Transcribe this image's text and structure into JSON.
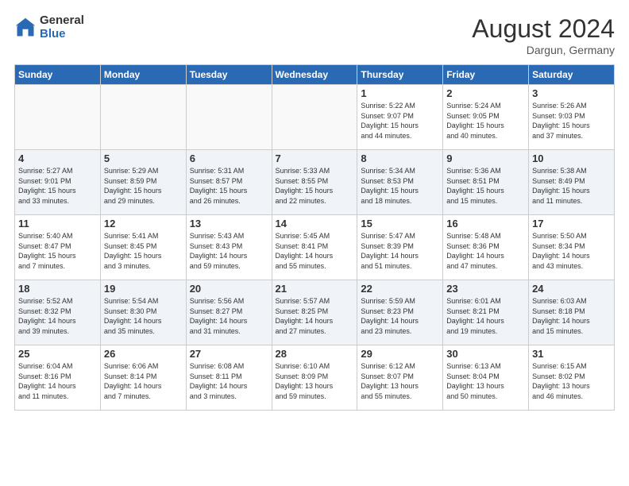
{
  "logo": {
    "general": "General",
    "blue": "Blue"
  },
  "header": {
    "month_year": "August 2024",
    "location": "Dargun, Germany"
  },
  "weekdays": [
    "Sunday",
    "Monday",
    "Tuesday",
    "Wednesday",
    "Thursday",
    "Friday",
    "Saturday"
  ],
  "weeks": [
    [
      {
        "day": "",
        "info": ""
      },
      {
        "day": "",
        "info": ""
      },
      {
        "day": "",
        "info": ""
      },
      {
        "day": "",
        "info": ""
      },
      {
        "day": "1",
        "info": "Sunrise: 5:22 AM\nSunset: 9:07 PM\nDaylight: 15 hours\nand 44 minutes."
      },
      {
        "day": "2",
        "info": "Sunrise: 5:24 AM\nSunset: 9:05 PM\nDaylight: 15 hours\nand 40 minutes."
      },
      {
        "day": "3",
        "info": "Sunrise: 5:26 AM\nSunset: 9:03 PM\nDaylight: 15 hours\nand 37 minutes."
      }
    ],
    [
      {
        "day": "4",
        "info": "Sunrise: 5:27 AM\nSunset: 9:01 PM\nDaylight: 15 hours\nand 33 minutes."
      },
      {
        "day": "5",
        "info": "Sunrise: 5:29 AM\nSunset: 8:59 PM\nDaylight: 15 hours\nand 29 minutes."
      },
      {
        "day": "6",
        "info": "Sunrise: 5:31 AM\nSunset: 8:57 PM\nDaylight: 15 hours\nand 26 minutes."
      },
      {
        "day": "7",
        "info": "Sunrise: 5:33 AM\nSunset: 8:55 PM\nDaylight: 15 hours\nand 22 minutes."
      },
      {
        "day": "8",
        "info": "Sunrise: 5:34 AM\nSunset: 8:53 PM\nDaylight: 15 hours\nand 18 minutes."
      },
      {
        "day": "9",
        "info": "Sunrise: 5:36 AM\nSunset: 8:51 PM\nDaylight: 15 hours\nand 15 minutes."
      },
      {
        "day": "10",
        "info": "Sunrise: 5:38 AM\nSunset: 8:49 PM\nDaylight: 15 hours\nand 11 minutes."
      }
    ],
    [
      {
        "day": "11",
        "info": "Sunrise: 5:40 AM\nSunset: 8:47 PM\nDaylight: 15 hours\nand 7 minutes."
      },
      {
        "day": "12",
        "info": "Sunrise: 5:41 AM\nSunset: 8:45 PM\nDaylight: 15 hours\nand 3 minutes."
      },
      {
        "day": "13",
        "info": "Sunrise: 5:43 AM\nSunset: 8:43 PM\nDaylight: 14 hours\nand 59 minutes."
      },
      {
        "day": "14",
        "info": "Sunrise: 5:45 AM\nSunset: 8:41 PM\nDaylight: 14 hours\nand 55 minutes."
      },
      {
        "day": "15",
        "info": "Sunrise: 5:47 AM\nSunset: 8:39 PM\nDaylight: 14 hours\nand 51 minutes."
      },
      {
        "day": "16",
        "info": "Sunrise: 5:48 AM\nSunset: 8:36 PM\nDaylight: 14 hours\nand 47 minutes."
      },
      {
        "day": "17",
        "info": "Sunrise: 5:50 AM\nSunset: 8:34 PM\nDaylight: 14 hours\nand 43 minutes."
      }
    ],
    [
      {
        "day": "18",
        "info": "Sunrise: 5:52 AM\nSunset: 8:32 PM\nDaylight: 14 hours\nand 39 minutes."
      },
      {
        "day": "19",
        "info": "Sunrise: 5:54 AM\nSunset: 8:30 PM\nDaylight: 14 hours\nand 35 minutes."
      },
      {
        "day": "20",
        "info": "Sunrise: 5:56 AM\nSunset: 8:27 PM\nDaylight: 14 hours\nand 31 minutes."
      },
      {
        "day": "21",
        "info": "Sunrise: 5:57 AM\nSunset: 8:25 PM\nDaylight: 14 hours\nand 27 minutes."
      },
      {
        "day": "22",
        "info": "Sunrise: 5:59 AM\nSunset: 8:23 PM\nDaylight: 14 hours\nand 23 minutes."
      },
      {
        "day": "23",
        "info": "Sunrise: 6:01 AM\nSunset: 8:21 PM\nDaylight: 14 hours\nand 19 minutes."
      },
      {
        "day": "24",
        "info": "Sunrise: 6:03 AM\nSunset: 8:18 PM\nDaylight: 14 hours\nand 15 minutes."
      }
    ],
    [
      {
        "day": "25",
        "info": "Sunrise: 6:04 AM\nSunset: 8:16 PM\nDaylight: 14 hours\nand 11 minutes."
      },
      {
        "day": "26",
        "info": "Sunrise: 6:06 AM\nSunset: 8:14 PM\nDaylight: 14 hours\nand 7 minutes."
      },
      {
        "day": "27",
        "info": "Sunrise: 6:08 AM\nSunset: 8:11 PM\nDaylight: 14 hours\nand 3 minutes."
      },
      {
        "day": "28",
        "info": "Sunrise: 6:10 AM\nSunset: 8:09 PM\nDaylight: 13 hours\nand 59 minutes."
      },
      {
        "day": "29",
        "info": "Sunrise: 6:12 AM\nSunset: 8:07 PM\nDaylight: 13 hours\nand 55 minutes."
      },
      {
        "day": "30",
        "info": "Sunrise: 6:13 AM\nSunset: 8:04 PM\nDaylight: 13 hours\nand 50 minutes."
      },
      {
        "day": "31",
        "info": "Sunrise: 6:15 AM\nSunset: 8:02 PM\nDaylight: 13 hours\nand 46 minutes."
      }
    ]
  ]
}
